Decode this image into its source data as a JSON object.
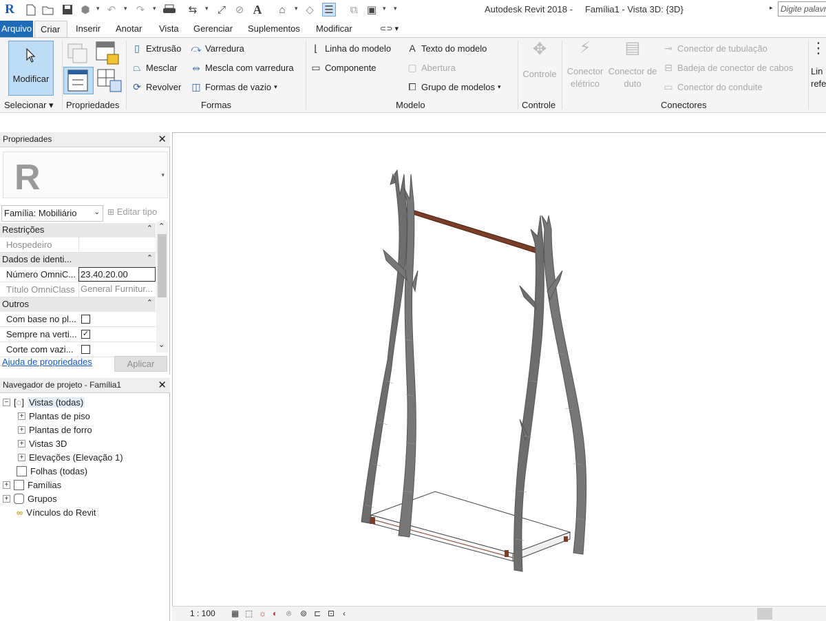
{
  "title_bar": {
    "app_title": "Autodesk Revit 2018 -     Família1 - Vista 3D: {3D}",
    "search_placeholder": "Digite palavra"
  },
  "tabs": [
    "Arquivo",
    "Criar",
    "Inserir",
    "Anotar",
    "Vista",
    "Gerenciar",
    "Suplementos",
    "Modificar"
  ],
  "ribbon": {
    "selecionar": {
      "modificar_label": "Modificar",
      "panel_label": "Selecionar"
    },
    "propriedades": {
      "panel_label": "Propriedades"
    },
    "formas": {
      "panel_label": "Formas",
      "extrusao": "Extrusão",
      "mesclar": "Mesclar",
      "revolver": "Revolver",
      "varredura": "Varredura",
      "mescla_varredura": "Mescla com varredura",
      "formas_vazio": "Formas de vazio"
    },
    "modelo": {
      "panel_label": "Modelo",
      "linha_modelo": "Linha do modelo",
      "componente": "Componente",
      "texto_modelo": "Texto do modelo",
      "abertura": "Abertura",
      "grupo_modelos": "Grupo de modelos"
    },
    "controle": {
      "panel_label": "Controle",
      "controle": "Controle"
    },
    "conectores": {
      "panel_label": "Conectores",
      "conector_eletrico_1": "Conector",
      "conector_eletrico_2": "elétrico",
      "conector_duto_1": "Conector de",
      "conector_duto_2": "duto",
      "tubulacao": "Conector de tubulação",
      "bandeja": "Badeja de conector de cabos",
      "conduite": "Conector do conduite"
    },
    "referencia_partial_1": "Lin",
    "referencia_partial_2": "refe"
  },
  "properties_panel": {
    "title": "Propriedades",
    "type_selector": "Família: Mobiliário",
    "edit_type": "Editar tipo",
    "groups": [
      {
        "label": "Restrições"
      },
      {
        "label": "Dados de identi..."
      },
      {
        "label": "Outros"
      }
    ],
    "rows": {
      "hospedeiro": {
        "name": "Hospedeiro",
        "value": ""
      },
      "numero_omniclass": {
        "name": "Número OmniC...",
        "value": "23.40.20.00"
      },
      "titulo_omniclass": {
        "name": "Título OmniClass",
        "value": "General Furnitur..."
      },
      "com_base": {
        "name": "Com base no pl...",
        "checked": false
      },
      "sempre_vertical": {
        "name": "Sempre na verti...",
        "checked": true
      },
      "corte_vazio": {
        "name": "Corte com vazi...",
        "checked": false
      }
    },
    "help_link": "Ajuda de propriedades",
    "apply_button": "Aplicar"
  },
  "project_browser": {
    "title": "Navegador de projeto - Família1",
    "nodes": [
      "Vistas (todas)",
      "Plantas de piso",
      "Plantas de forro",
      "Vistas 3D",
      "Elevações (Elevação 1)",
      "Folhas (todas)",
      "Famílias",
      "Grupos",
      "Vínculos do Revit"
    ]
  },
  "view_bar": {
    "scale": "1 : 100"
  },
  "colors": {
    "accent": "#1e6bb8",
    "active_button": "#bfdcf5",
    "model_gray": "#6e6e6e",
    "rod_brown": "#7a3e28"
  }
}
